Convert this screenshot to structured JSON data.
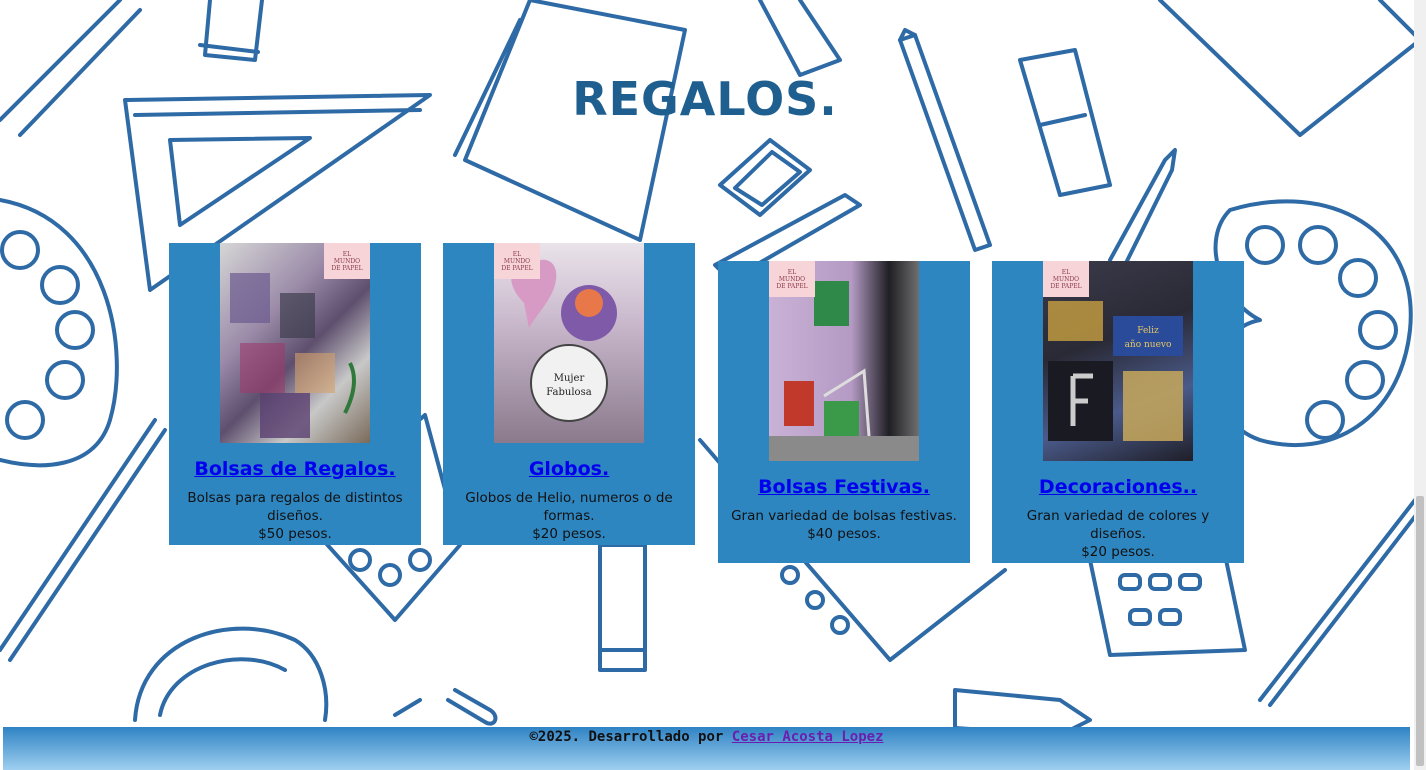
{
  "header": {
    "title": "REGALOS."
  },
  "products": [
    {
      "title": "Bolsas de Regalos.",
      "description": "Bolsas para regalos de distintos diseños.",
      "price": "$50 pesos.",
      "image_icon": "gift-bags-photo-icon",
      "photo_colors": [
        "#c9c9c9",
        "#8a6d9a",
        "#5a5a5a"
      ]
    },
    {
      "title": "Globos.",
      "description": "Globos de Helio, numeros o de formas.",
      "price": "$20 pesos.",
      "image_icon": "balloons-photo-icon",
      "photo_colors": [
        "#d9a6c8",
        "#7f5fa8",
        "#e8e8e8"
      ]
    },
    {
      "title": "Bolsas Festivas.",
      "description": "Gran variedad de bolsas festivas.",
      "price": "$40 pesos.",
      "image_icon": "festive-bags-photo-icon",
      "photo_colors": [
        "#b9a0c8",
        "#3c8a4a",
        "#c0392b"
      ]
    },
    {
      "title": "Decoraciones..",
      "description": "Gran variedad de colores y diseños.",
      "price": "$20 pesos.",
      "image_icon": "decorations-photo-icon",
      "photo_colors": [
        "#2a2a3a",
        "#c8a040",
        "#4a6ab0"
      ]
    }
  ],
  "logo_chip": {
    "line1": "EL",
    "line2": "MUNDO",
    "line3": "DE PAPEL"
  },
  "footer": {
    "text": "©2025. Desarrollado por ",
    "author": "Cesar Acosta Lopez"
  },
  "colors": {
    "accent": "#2e86c1",
    "title": "#1e5f90",
    "link": "#0000ee",
    "visited_link": "#6a1fb0",
    "outline_art": "#2e6aa5"
  }
}
